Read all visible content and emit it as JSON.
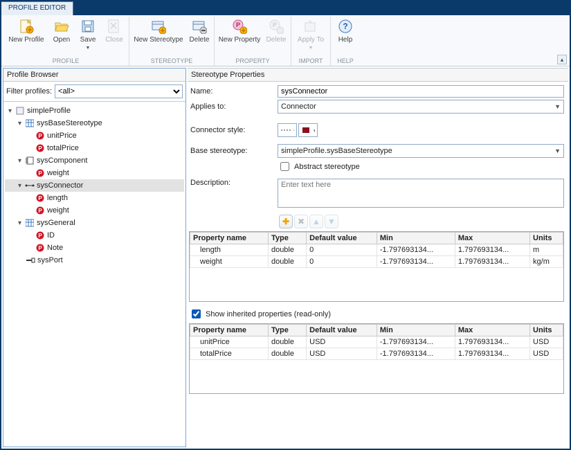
{
  "tab": "PROFILE EDITOR",
  "ribbon": {
    "groups": [
      {
        "label": "PROFILE",
        "buttons": [
          "New Profile",
          "Open",
          "Save",
          "Close"
        ]
      },
      {
        "label": "STEREOTYPE",
        "buttons": [
          "New Stereotype",
          "Delete"
        ]
      },
      {
        "label": "PROPERTY",
        "buttons": [
          "New Property",
          "Delete"
        ]
      },
      {
        "label": "IMPORT",
        "buttons": [
          "Apply To"
        ]
      },
      {
        "label": "HELP",
        "buttons": [
          "Help"
        ]
      }
    ]
  },
  "browser": {
    "title": "Profile Browser",
    "filterLabel": "Filter profiles:",
    "filterValue": "<all>",
    "root": "simpleProfile",
    "nodes": {
      "sysBase": "sysBaseStereotype",
      "unitPrice": "unitPrice",
      "totalPrice": "totalPrice",
      "sysComponent": "sysComponent",
      "weight": "weight",
      "sysConnector": "sysConnector",
      "length": "length",
      "weight2": "weight",
      "sysGeneral": "sysGeneral",
      "id": "ID",
      "note": "Note",
      "sysPort": "sysPort"
    }
  },
  "props": {
    "title": "Stereotype Properties",
    "labels": {
      "name": "Name:",
      "applies": "Applies to:",
      "connStyle": "Connector style:",
      "base": "Base stereotype:",
      "abstract": "Abstract stereotype",
      "desc": "Description:",
      "descPlaceholder": "Enter text here",
      "showInherited": "Show inherited properties (read-only)"
    },
    "values": {
      "name": "sysConnector",
      "applies": "Connector",
      "base": "simpleProfile.sysBaseStereotype",
      "abstract": false,
      "showInherited": true
    },
    "tableHeaders": [
      "Property name",
      "Type",
      "Default value",
      "Min",
      "Max",
      "Units"
    ],
    "ownProps": [
      {
        "name": "length",
        "type": "double",
        "default": "0",
        "min": "-1.797693134...",
        "max": "1.797693134...",
        "units": "m"
      },
      {
        "name": "weight",
        "type": "double",
        "default": "0",
        "min": "-1.797693134...",
        "max": "1.797693134...",
        "units": "kg/m"
      }
    ],
    "inheritedProps": [
      {
        "name": "unitPrice",
        "type": "double",
        "default": "USD",
        "min": "-1.797693134...",
        "max": "1.797693134...",
        "units": "USD"
      },
      {
        "name": "totalPrice",
        "type": "double",
        "default": "USD",
        "min": "-1.797693134...",
        "max": "1.797693134...",
        "units": "USD"
      }
    ]
  }
}
